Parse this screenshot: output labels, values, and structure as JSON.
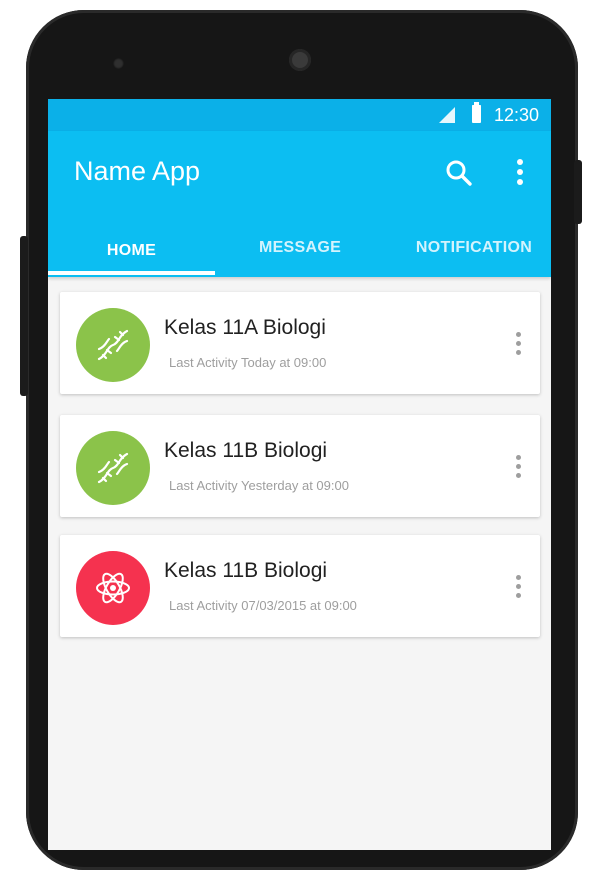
{
  "status_bar": {
    "time": "12:30"
  },
  "app_bar": {
    "title": "Name App",
    "icons": {
      "search": "search-icon",
      "more": "more-vertical-icon"
    },
    "color": "#0cbef2"
  },
  "tabs": [
    {
      "label": "HOME",
      "active": true
    },
    {
      "label": "MESSAGE",
      "active": false
    },
    {
      "label": "NOTIFICATION",
      "active": false
    }
  ],
  "classes": [
    {
      "title": "Kelas 11A Biologi",
      "subtitle": "Last Activity Today at 09:00",
      "icon": "dna-icon",
      "color": "#8bc34a"
    },
    {
      "title": "Kelas 11B Biologi",
      "subtitle": "Last Activity Yesterday at 09:00",
      "icon": "dna-icon",
      "color": "#8bc34a"
    },
    {
      "title": "Kelas 11B Biologi",
      "subtitle": "Last Activity 07/03/2015 at 09:00",
      "icon": "atom-icon",
      "color": "#f5324f"
    }
  ]
}
